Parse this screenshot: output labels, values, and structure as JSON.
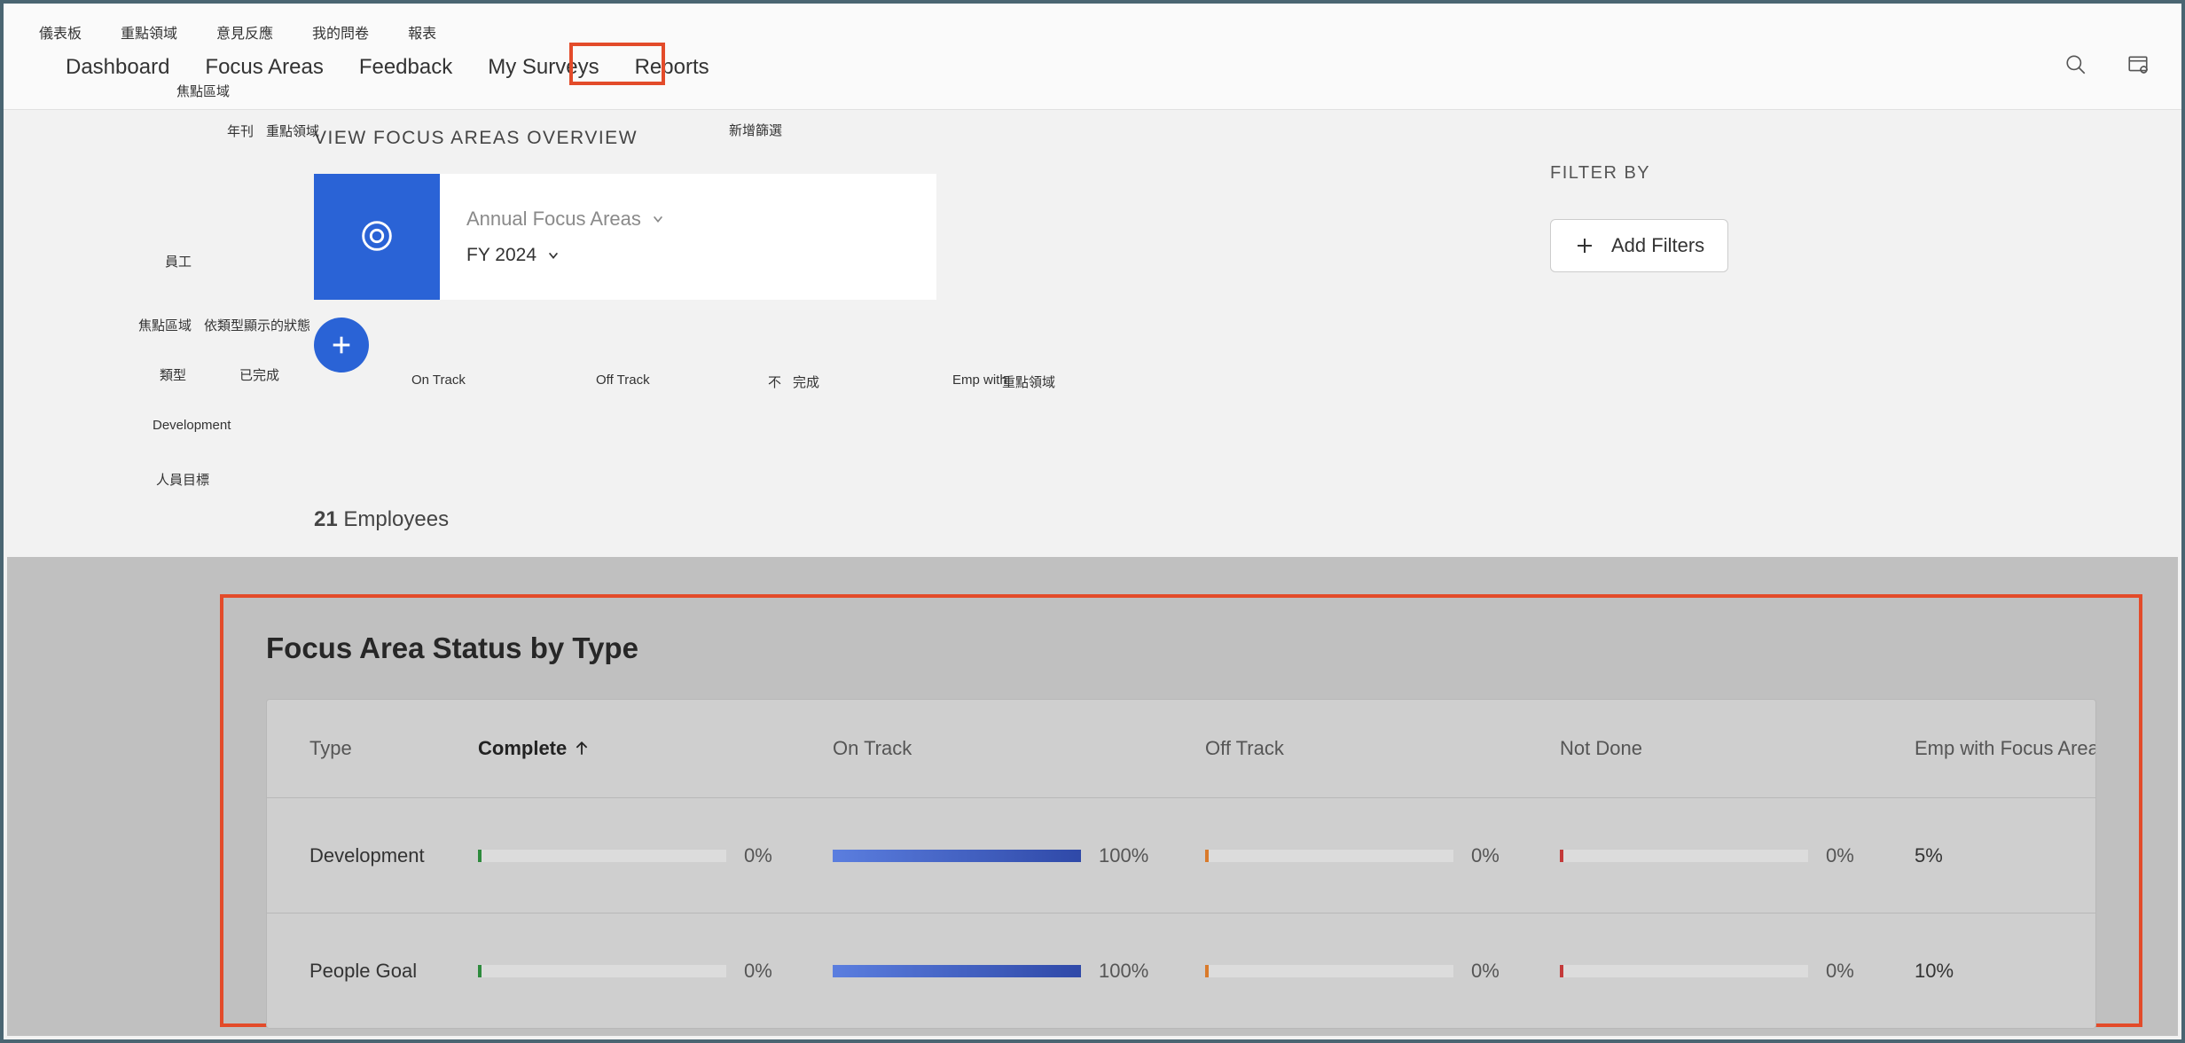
{
  "topnav": {
    "row1": [
      "儀表板",
      "重點領域",
      "意見反應",
      "我的問卷",
      "報表"
    ],
    "row2": [
      "Dashboard",
      "Focus Areas",
      "Feedback",
      "My Surveys",
      "Reports"
    ],
    "row3": "焦點區域"
  },
  "sidebar": {
    "l1": "年刊",
    "l2": "重點領域",
    "l3": "員工",
    "l4": "焦點區域",
    "l5": "依類型顯示的狀態",
    "l6": "類型",
    "l7": "已完成",
    "l8": "Development",
    "l9": "人員目標"
  },
  "overview": {
    "title": "VIEW FOCUS AREAS OVERVIEW",
    "dropdown1": "Annual Focus Areas",
    "dropdown2": "FY 2024",
    "labels": {
      "ontrack": "On Track",
      "offtrack": "Off Track",
      "not": "不",
      "done": "完成",
      "empwith": "Emp with",
      "focusareas": "重點領域",
      "newpipeline": "新增篩選"
    },
    "emp_count_num": "21",
    "emp_count_label": "Employees"
  },
  "filter": {
    "title": "FILTER BY",
    "add": "Add Filters"
  },
  "status": {
    "title": "Focus Area Status by Type",
    "headers": [
      "Type",
      "Complete",
      "On Track",
      "Off Track",
      "Not Done",
      "Emp with Focus Areas"
    ],
    "rows": [
      {
        "type": "Development",
        "complete": {
          "pct": "0%",
          "fill": 0,
          "color": "#2e8b3d",
          "tick": true
        },
        "ontrack": {
          "pct": "100%",
          "fill": 100,
          "color": "#3a5fc8",
          "tick": false
        },
        "offtrack": {
          "pct": "0%",
          "fill": 0,
          "color": "#d97a2b",
          "tick": true
        },
        "notdone": {
          "pct": "0%",
          "fill": 0,
          "color": "#c43a3a",
          "tick": true
        },
        "emp": "5%"
      },
      {
        "type": "People Goal",
        "complete": {
          "pct": "0%",
          "fill": 0,
          "color": "#2e8b3d",
          "tick": true
        },
        "ontrack": {
          "pct": "100%",
          "fill": 100,
          "color": "#3a5fc8",
          "tick": false
        },
        "offtrack": {
          "pct": "0%",
          "fill": 0,
          "color": "#d97a2b",
          "tick": true
        },
        "notdone": {
          "pct": "0%",
          "fill": 0,
          "color": "#c43a3a",
          "tick": true
        },
        "emp": "10%"
      }
    ]
  },
  "chart_data": {
    "type": "table",
    "title": "Focus Area Status by Type",
    "columns": [
      "Type",
      "Complete",
      "On Track",
      "Off Track",
      "Not Done",
      "Emp with Focus Areas"
    ],
    "rows": [
      {
        "Type": "Development",
        "Complete": 0,
        "On Track": 100,
        "Off Track": 0,
        "Not Done": 0,
        "Emp with Focus Areas": 5
      },
      {
        "Type": "People Goal",
        "Complete": 0,
        "On Track": 100,
        "Off Track": 0,
        "Not Done": 0,
        "Emp with Focus Areas": 10
      }
    ],
    "units": "percent"
  }
}
